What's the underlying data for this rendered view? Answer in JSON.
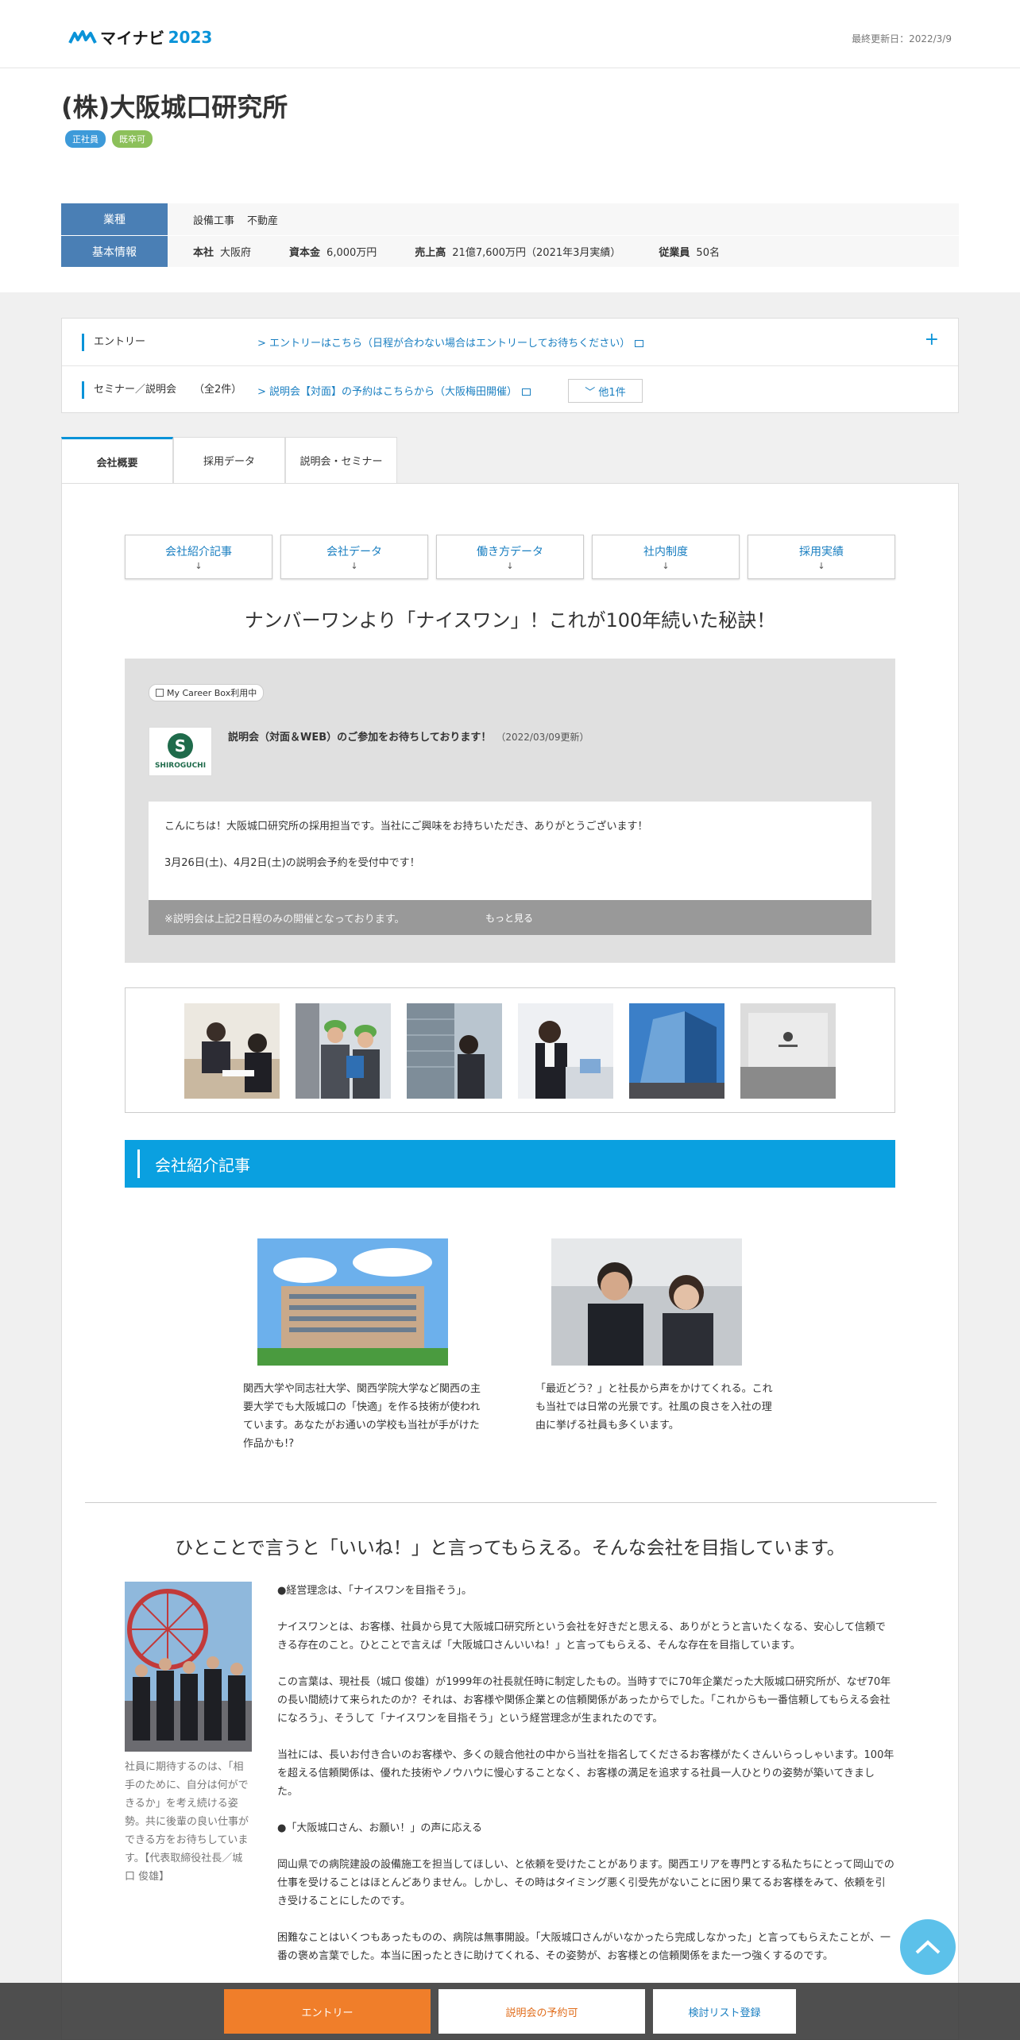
{
  "header": {
    "logo_name": "マイナビ",
    "logo_year": "2023",
    "updated": "最終更新日：2022/3/9"
  },
  "company": {
    "name": "(株)大阪城口研究所",
    "badges": [
      "正社員",
      "既卒可"
    ]
  },
  "info": {
    "industry_label": "業種",
    "industries": [
      "設備工事",
      "不動産"
    ],
    "basic_label": "基本情報",
    "hq_label": "本社",
    "hq_value": "大阪府",
    "capital_label": "資本金",
    "capital_value": "6,000万円",
    "sales_label": "売上高",
    "sales_value": "21億7,600万円（2021年3月実績）",
    "employees_label": "従業員",
    "employees_value": "50名"
  },
  "entry": {
    "entry_label": "エントリー",
    "entry_link": "> エントリーはこちら（日程が合わない場合はエントリーしてお待ちください）",
    "seminar_label": "セミナー／説明会",
    "seminar_count": "（全2件）",
    "seminar_link": "> 説明会【対面】の予約はこちらから（大阪梅田開催）",
    "other_button": "﹀ 他1件",
    "expand": "+"
  },
  "tabs": [
    "会社概要",
    "採用データ",
    "説明会・セミナー"
  ],
  "anchors": [
    {
      "label": "会社紹介記事",
      "arrow": "↓"
    },
    {
      "label": "会社データ",
      "arrow": "↓"
    },
    {
      "label": "働き方データ",
      "arrow": "↓"
    },
    {
      "label": "社内制度",
      "arrow": "↓"
    },
    {
      "label": "採用実績",
      "arrow": "↓"
    }
  ],
  "headline": "ナンバーワンより「ナイスワン」！これが100年続いた秘訣！",
  "mcb": {
    "badge": "My Career Box利用中",
    "logo_letter": "S",
    "logo_text": "SHIROGUCHI",
    "title": "説明会（対面＆WEB）のご参加をお待ちしております！",
    "date": "（2022/03/09更新）",
    "para1": "こんにちは！大阪城口研究所の採用担当です。当社にご興味をお持ちいただき、ありがとうございます！",
    "para2": "3月26日(土)、4月2日(土)の説明会予約を受付中です！",
    "note": "※説明会は上記2日程のみの開催となっております。",
    "more": "もっと見る"
  },
  "section_title": "会社紹介記事",
  "articles": [
    {
      "caption": "関西大学や同志社大学、関西学院大学など関西の主要大学でも大阪城口の「快適」を作る技術が使われています。あなたがお通いの学校も当社が手がけた作品かも!?"
    },
    {
      "caption": "「最近どう？」と社長から声をかけてくれる。これも当社では日常の光景です。社風の良さを入社の理由に挙げる社員も多くいます。"
    }
  ],
  "philosophy": {
    "title": "ひとことで言うと「いいね！」と言ってもらえる。そんな会社を目指しています。",
    "photo_caption": "社員に期待するのは、「相手のために、自分は何ができるか」を考え続ける姿勢。共に後輩の良い仕事ができる方をお待ちしています。【代表取締役社長／城口 俊雄】",
    "paragraphs": [
      "●経営理念は、「ナイスワンを目指そう」。",
      "ナイスワンとは、お客様、社員から見て大阪城口研究所という会社を好きだと思える、ありがとうと言いたくなる、安心して信頼できる存在のこと。ひとことで言えば「大阪城口さんいいね！」と言ってもらえる、そんな存在を目指しています。",
      "この言葉は、現社長（城口 俊雄）が1999年の社長就任時に制定したもの。当時すでに70年企業だった大阪城口研究所が、なぜ70年の長い間続けて来られたのか？それは、お客様や関係企業との信頼関係があったからでした。「これからも一番信頼してもらえる会社になろう」、そうして「ナイスワンを目指そう」という経営理念が生まれたのです。",
      "当社には、長いお付き合いのお客様や、多くの競合他社の中から当社を指名してくださるお客様がたくさんいらっしゃいます。100年を超える信頼関係は、優れた技術やノウハウに慢心することなく、お客様の満足を追求する社員一人ひとりの姿勢が築いてきました。",
      "●「大阪城口さん、お願い！」の声に応える",
      "岡山県での病院建設の設備施工を担当してほしい、と依頼を受けたことがあります。関西エリアを専門とする私たちにとって岡山での仕事を受けることはほとんどありません。しかし、その時はタイミング悪く引受先がないことに困り果てるお客様をみて、依頼を引き受けることにしたのです。",
      "困難なことはいくつもあったものの、病院は無事開設。「大阪城口さんがいなかったら完成しなかった」と言ってもらえたことが、一番の褒め言葉でした。本当に困ったときに助けてくれる、その姿勢が、お客様との信頼関係をまた一つ強くするのです。"
    ]
  },
  "bottom": {
    "entry": "エントリー",
    "seminar": "説明会の予約可",
    "list": "検討リスト登録"
  }
}
